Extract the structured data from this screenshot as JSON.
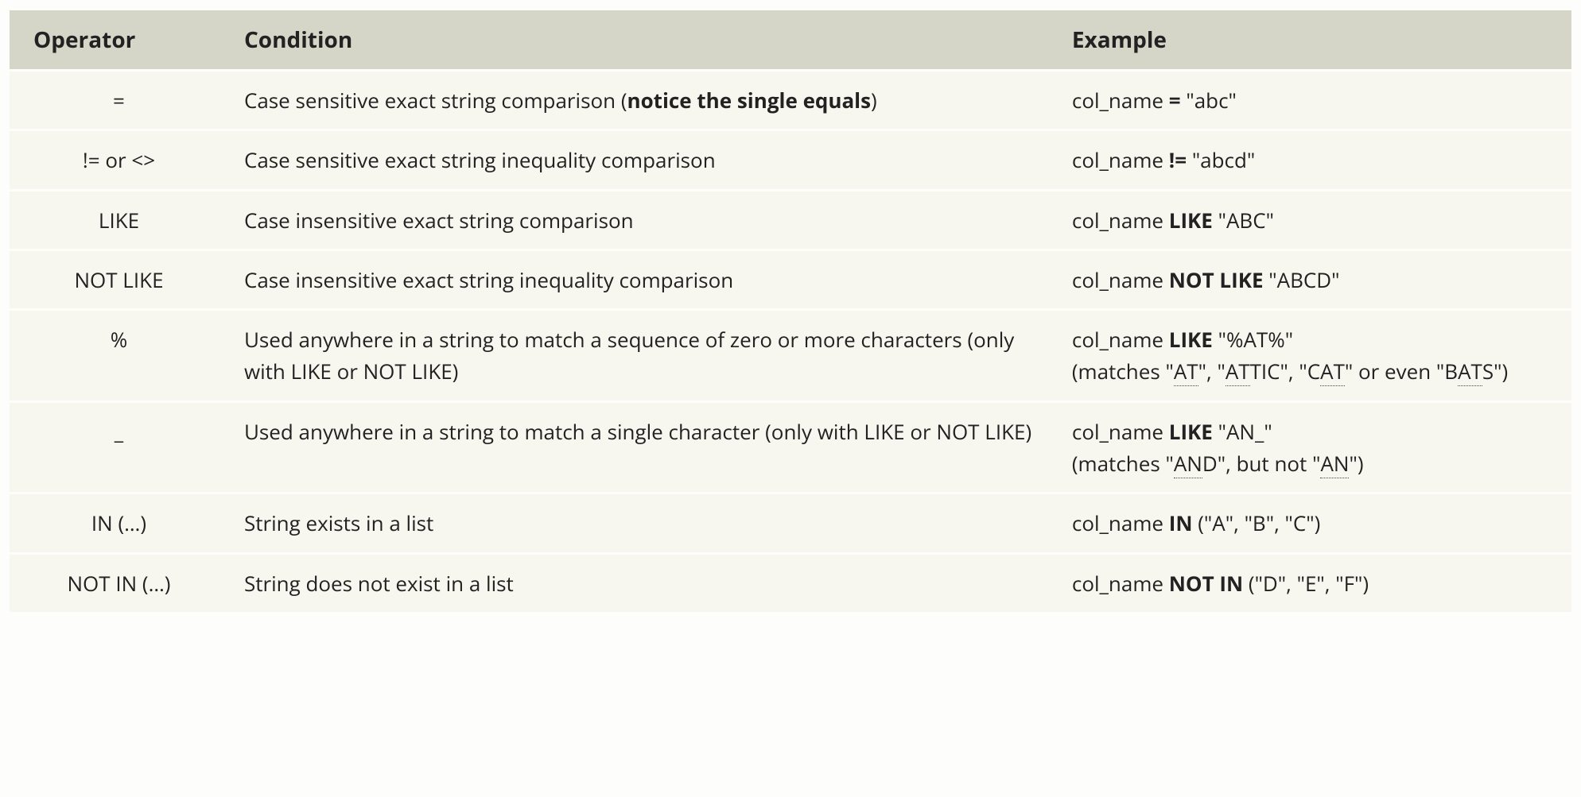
{
  "headers": {
    "operator": "Operator",
    "condition": "Condition",
    "example": "Example"
  },
  "rows": [
    {
      "op": "=",
      "cond_pre": "Case sensitive exact string comparison (",
      "cond_bold": "notice the single equals",
      "cond_post": ")",
      "ex_pre": "col_name ",
      "ex_bold": "=",
      "ex_post": " \"abc\""
    },
    {
      "op": "!= or <>",
      "cond_pre": "Case sensitive exact string inequality comparison",
      "cond_bold": "",
      "cond_post": "",
      "ex_pre": "col_name ",
      "ex_bold": "!=",
      "ex_post": " \"abcd\""
    },
    {
      "op": "LIKE",
      "cond_pre": "Case insensitive exact string comparison",
      "cond_bold": "",
      "cond_post": "",
      "ex_pre": "col_name ",
      "ex_bold": "LIKE",
      "ex_post": " \"ABC\""
    },
    {
      "op": "NOT LIKE",
      "cond_pre": "Case insensitive exact string inequality comparison",
      "cond_bold": "",
      "cond_post": "",
      "ex_pre": "col_name ",
      "ex_bold": "NOT LIKE",
      "ex_post": " \"ABCD\""
    },
    {
      "op": "%",
      "cond_pre": "Used anywhere in a string to match a sequence of zero or more characters (only with LIKE or NOT LIKE)",
      "cond_bold": "",
      "cond_post": "",
      "ex_pre": "col_name ",
      "ex_bold": "LIKE",
      "ex_post_html": " \"%AT%\"<br>(matches \"<span class='u2'>AT</span>\", \"<span class='u2'>AT</span>TIC\", \"C<span class='u2'>AT</span>\" or even \"B<span class='u2'>AT</span>S\")"
    },
    {
      "op": "_",
      "cond_pre": "Used anywhere in a string to match a single character (only with LIKE or NOT LIKE)",
      "cond_bold": "",
      "cond_post": "",
      "ex_pre": "col_name ",
      "ex_bold": "LIKE",
      "ex_post_html": " \"AN_\"<br>(matches \"<span class='u2'>AN</span>D\", but not \"<span class='u2'>AN</span>\")"
    },
    {
      "op": "IN (…)",
      "cond_pre": "String exists in a list",
      "cond_bold": "",
      "cond_post": "",
      "ex_pre": "col_name ",
      "ex_bold": "IN",
      "ex_post": " (\"A\", \"B\", \"C\")"
    },
    {
      "op": "NOT IN (…)",
      "cond_pre": "String does not exist in a list",
      "cond_bold": "",
      "cond_post": "",
      "ex_pre": "col_name ",
      "ex_bold": "NOT IN",
      "ex_post": " (\"D\", \"E\", \"F\")"
    }
  ]
}
